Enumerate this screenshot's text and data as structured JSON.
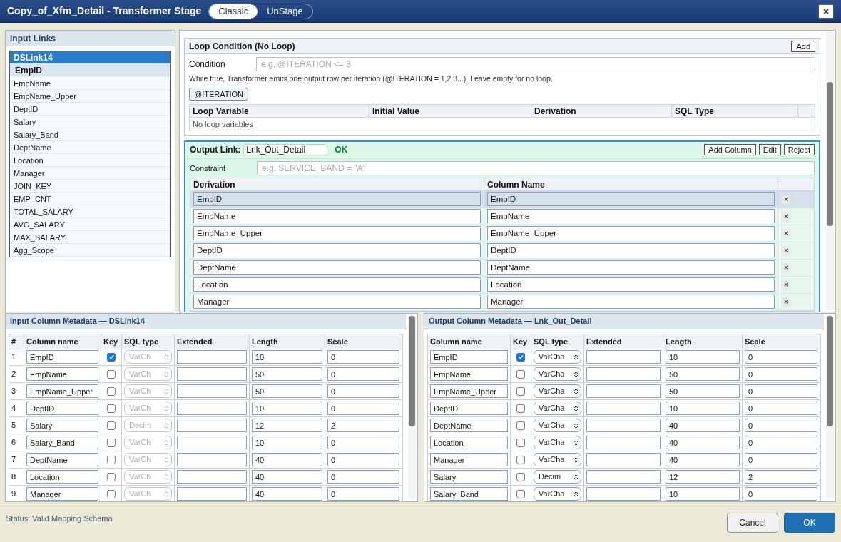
{
  "window": {
    "title": "Copy_of_Xfm_Detail - Transformer Stage",
    "modes": [
      {
        "label": "Classic",
        "selected": true
      },
      {
        "label": "UnStage",
        "selected": false
      }
    ],
    "close": "×"
  },
  "input_links": {
    "title": "Input Links",
    "items": [
      {
        "label": "DSLink14",
        "kind": "link",
        "selected": true
      },
      {
        "label": "EmpID",
        "kind": "column",
        "selected": true
      },
      {
        "label": "EmpName",
        "kind": "column",
        "selected": false
      },
      {
        "label": "EmpName_Upper",
        "kind": "column",
        "selected": false
      },
      {
        "label": "DeptID",
        "kind": "column",
        "selected": false
      },
      {
        "label": "Salary",
        "kind": "column",
        "selected": false
      },
      {
        "label": "Salary_Band",
        "kind": "column",
        "selected": false
      },
      {
        "label": "DeptName",
        "kind": "column",
        "selected": false
      },
      {
        "label": "Location",
        "kind": "column",
        "selected": false
      },
      {
        "label": "Manager",
        "kind": "column",
        "selected": false
      },
      {
        "label": "JOIN_KEY",
        "kind": "column",
        "selected": false
      },
      {
        "label": "EMP_CNT",
        "kind": "column",
        "selected": false
      },
      {
        "label": "TOTAL_SALARY",
        "kind": "column",
        "selected": false
      },
      {
        "label": "AVG_SALARY",
        "kind": "column",
        "selected": false
      },
      {
        "label": "MAX_SALARY",
        "kind": "column",
        "selected": false
      },
      {
        "label": "Agg_Scope",
        "kind": "column",
        "selected": false
      }
    ]
  },
  "loop": {
    "title": "Loop Condition (No Loop)",
    "add_button": "Add",
    "condition_label": "Condition",
    "condition_placeholder": "e.g. @ITERATION <= 3",
    "help": "While true, Transformer emits one output row per iteration (@ITERATION = 1,2,3...). Leave empty for no loop.",
    "iteration_button": "@ITERATION",
    "columns": [
      "Loop Variable",
      "Initial Value",
      "Derivation",
      "SQL Type"
    ],
    "empty": "No loop variables"
  },
  "output_link": {
    "label": "Output Link:",
    "name": "Lnk_Out_Detail",
    "status": "OK",
    "buttons": [
      "Add Column",
      "Edit",
      "Reject"
    ],
    "constraint_label": "Constraint",
    "constraint_placeholder": "e.g. SERVICE_BAND = \"A\"",
    "columns": [
      "Derivation",
      "Column Name"
    ],
    "delete": "×",
    "rows": [
      {
        "derivation": "EmpID",
        "column": "EmpID",
        "selected": true
      },
      {
        "derivation": "EmpName",
        "column": "EmpName",
        "selected": false
      },
      {
        "derivation": "EmpName_Upper",
        "column": "EmpName_Upper",
        "selected": false
      },
      {
        "derivation": "DeptID",
        "column": "DeptID",
        "selected": false
      },
      {
        "derivation": "DeptName",
        "column": "DeptName",
        "selected": false
      },
      {
        "derivation": "Location",
        "column": "Location",
        "selected": false
      },
      {
        "derivation": "Manager",
        "column": "Manager",
        "selected": false
      }
    ]
  },
  "input_metadata": {
    "title": "Input Column Metadata — DSLink14",
    "sql_disabled": true,
    "columns": [
      "#",
      "Column name",
      "Key",
      "SQL type",
      "Extended",
      "Length",
      "Scale"
    ],
    "rows": [
      {
        "n": "1",
        "name": "EmpID",
        "key": true,
        "sql": "VarCh",
        "length": "10",
        "scale": "0"
      },
      {
        "n": "2",
        "name": "EmpName",
        "key": false,
        "sql": "VarCh",
        "length": "50",
        "scale": "0"
      },
      {
        "n": "3",
        "name": "EmpName_Upper",
        "key": false,
        "sql": "VarCh",
        "length": "50",
        "scale": "0"
      },
      {
        "n": "4",
        "name": "DeptID",
        "key": false,
        "sql": "VarCh",
        "length": "10",
        "scale": "0"
      },
      {
        "n": "5",
        "name": "Salary",
        "key": false,
        "sql": "Decim",
        "length": "12",
        "scale": "2"
      },
      {
        "n": "6",
        "name": "Salary_Band",
        "key": false,
        "sql": "VarCh",
        "length": "10",
        "scale": "0"
      },
      {
        "n": "7",
        "name": "DeptName",
        "key": false,
        "sql": "VarCh",
        "length": "40",
        "scale": "0"
      },
      {
        "n": "8",
        "name": "Location",
        "key": false,
        "sql": "VarCh",
        "length": "40",
        "scale": "0"
      },
      {
        "n": "9",
        "name": "Manager",
        "key": false,
        "sql": "VarCh",
        "length": "40",
        "scale": "0"
      }
    ]
  },
  "output_metadata": {
    "title": "Output Column Metadata — Lnk_Out_Detail",
    "sql_disabled": false,
    "columns": [
      "Column name",
      "Key",
      "SQL type",
      "Extended",
      "Length",
      "Scale"
    ],
    "rows": [
      {
        "name": "EmpID",
        "key": true,
        "sql": "VarCha",
        "length": "10",
        "scale": "0"
      },
      {
        "name": "EmpName",
        "key": false,
        "sql": "VarCha",
        "length": "50",
        "scale": "0"
      },
      {
        "name": "EmpName_Upper",
        "key": false,
        "sql": "VarCha",
        "length": "50",
        "scale": "0"
      },
      {
        "name": "DeptID",
        "key": false,
        "sql": "VarCha",
        "length": "10",
        "scale": "0"
      },
      {
        "name": "DeptName",
        "key": false,
        "sql": "VarCha",
        "length": "40",
        "scale": "0"
      },
      {
        "name": "Location",
        "key": false,
        "sql": "VarCha",
        "length": "40",
        "scale": "0"
      },
      {
        "name": "Manager",
        "key": false,
        "sql": "VarCha",
        "length": "40",
        "scale": "0"
      },
      {
        "name": "Salary",
        "key": false,
        "sql": "Decim",
        "length": "12",
        "scale": "2"
      },
      {
        "name": "Salary_Band",
        "key": false,
        "sql": "VarCha",
        "length": "10",
        "scale": "0"
      }
    ]
  },
  "status_bar": {
    "status": "Status: Valid Mapping Schema",
    "buttons": [
      {
        "label": "Cancel",
        "kind": "secondary"
      },
      {
        "label": "OK",
        "kind": "primary"
      }
    ]
  }
}
